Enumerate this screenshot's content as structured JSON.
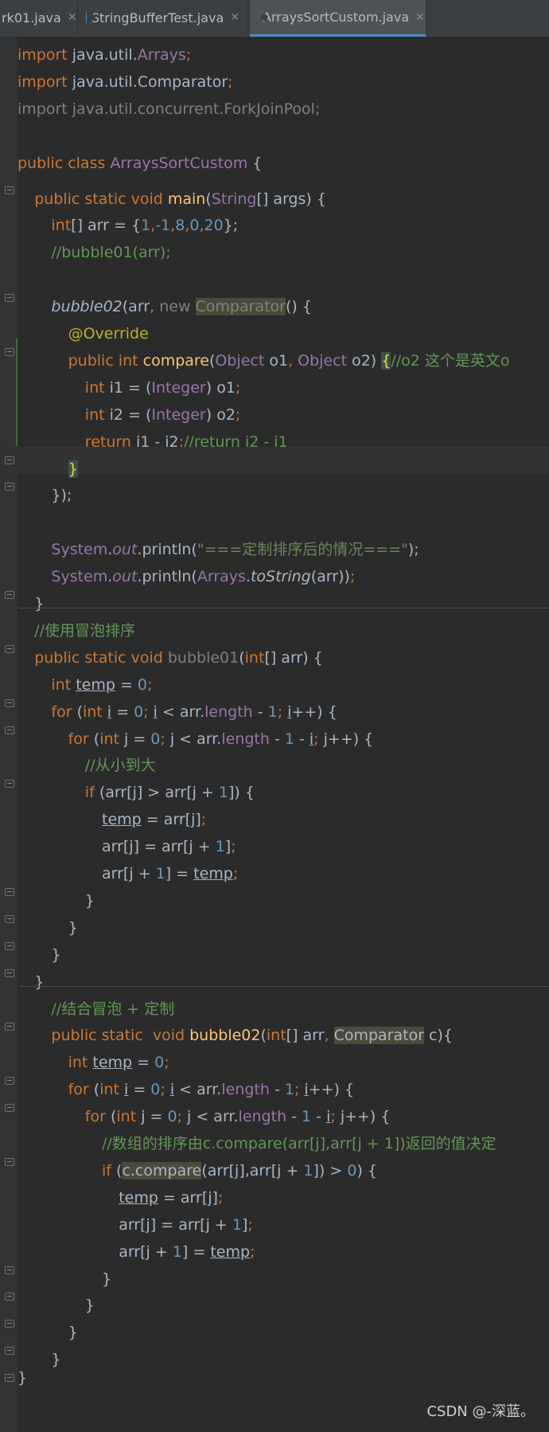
{
  "tabs": [
    {
      "label": "rk01.java",
      "active": false
    },
    {
      "label": "StringBufferTest.java",
      "active": false
    },
    {
      "label": "ArraysSortCustom.java",
      "active": true
    }
  ],
  "lines": [
    [
      [
        "import",
        "k"
      ],
      [
        " java.util.",
        "t"
      ],
      [
        "Arrays",
        "cy"
      ],
      [
        ";",
        "k"
      ]
    ],
    [
      [
        "import",
        "k"
      ],
      [
        " java.util.",
        "t"
      ],
      [
        "Comparator",
        "t"
      ],
      [
        ";",
        "k"
      ]
    ],
    [
      [
        "import java.util.concurrent.ForkJoinPool;",
        "g"
      ]
    ],
    [],
    [
      [
        "public class ",
        "k"
      ],
      [
        "ArraysSortCustom",
        "cy"
      ],
      [
        " {",
        "t"
      ]
    ],
    [
      [
        "  ",
        "t"
      ],
      [
        "public static void ",
        "k"
      ],
      [
        "main",
        "m"
      ],
      [
        "(",
        "t"
      ],
      [
        "String",
        "cy"
      ],
      [
        "[] args) {",
        "t"
      ]
    ],
    [
      [
        "    ",
        "t"
      ],
      [
        "int",
        "k"
      ],
      [
        "[] arr = {",
        "t"
      ],
      [
        "1",
        "n"
      ],
      [
        ",",
        "k"
      ],
      [
        "-1",
        "n"
      ],
      [
        ",",
        "k"
      ],
      [
        "8",
        "n"
      ],
      [
        ",",
        "k"
      ],
      [
        "0",
        "n"
      ],
      [
        ",",
        "k"
      ],
      [
        "20",
        "n"
      ],
      [
        "};",
        "t"
      ]
    ],
    [
      [
        "    ",
        "t"
      ],
      [
        "//bubble01(arr);",
        "cg"
      ]
    ],
    [],
    [
      [
        "    ",
        "t"
      ],
      [
        "bubble02",
        "it"
      ],
      [
        "(arr",
        "t"
      ],
      [
        ", ",
        "k"
      ],
      [
        "new ",
        "g"
      ],
      [
        "Comparator",
        "hlg"
      ],
      [
        "() {",
        "t"
      ]
    ],
    [
      [
        "      ",
        "t"
      ],
      [
        "@Override",
        "a"
      ]
    ],
    [
      [
        "      ",
        "t"
      ],
      [
        "public int ",
        "k"
      ],
      [
        "compare",
        "m"
      ],
      [
        "(",
        "t"
      ],
      [
        "Object ",
        "cy"
      ],
      [
        "o1",
        "t"
      ],
      [
        ", ",
        "k"
      ],
      [
        "Object ",
        "cy"
      ],
      [
        "o2) ",
        "t"
      ],
      [
        "{",
        "br"
      ],
      [
        "//o2 这个是英文o",
        "cg"
      ]
    ],
    [
      [
        "        ",
        "t"
      ],
      [
        "int ",
        "k"
      ],
      [
        "i1 = (",
        "t"
      ],
      [
        "Integer",
        "cy"
      ],
      [
        ") o1",
        "t"
      ],
      [
        ";",
        "k"
      ]
    ],
    [
      [
        "        ",
        "t"
      ],
      [
        "int ",
        "k"
      ],
      [
        "i2 = (",
        "t"
      ],
      [
        "Integer",
        "cy"
      ],
      [
        ") o2",
        "t"
      ],
      [
        ";",
        "k"
      ]
    ],
    [
      [
        "        ",
        "t"
      ],
      [
        "return ",
        "k"
      ],
      [
        "i1 - i2",
        "t"
      ],
      [
        ";",
        "k"
      ],
      [
        "//return i2 - i1",
        "cg"
      ]
    ],
    [
      [
        "      ",
        "t"
      ],
      [
        "}",
        "br"
      ]
    ],
    [
      [
        "    ",
        "t"
      ],
      [
        "});",
        "t"
      ]
    ],
    [],
    [
      [
        "    ",
        "t"
      ],
      [
        "System",
        "cy"
      ],
      [
        ".",
        "t"
      ],
      [
        "out",
        "cyi"
      ],
      [
        ".println(",
        "t"
      ],
      [
        "\"===定制排序后的情况===\"",
        "s"
      ],
      [
        ");",
        "t"
      ]
    ],
    [
      [
        "    ",
        "t"
      ],
      [
        "System",
        "cy"
      ],
      [
        ".",
        "t"
      ],
      [
        "out",
        "cyi"
      ],
      [
        ".println(",
        "t"
      ],
      [
        "Arrays",
        "cy"
      ],
      [
        ".",
        "t"
      ],
      [
        "toString",
        "it"
      ],
      [
        "(arr))",
        "t"
      ],
      [
        ";",
        "k"
      ]
    ],
    [
      [
        "  ",
        "t"
      ],
      [
        "}",
        "t"
      ]
    ],
    [
      [
        "  ",
        "t"
      ],
      [
        "//使用冒泡排序",
        "cg"
      ]
    ],
    [
      [
        "  ",
        "t"
      ],
      [
        "public static void ",
        "k"
      ],
      [
        "bubble01",
        "g"
      ],
      [
        "(",
        "t"
      ],
      [
        "int",
        "k"
      ],
      [
        "[] arr) {",
        "t"
      ]
    ],
    [
      [
        "    ",
        "t"
      ],
      [
        "int ",
        "k"
      ],
      [
        "temp",
        "ul"
      ],
      [
        " = ",
        "t"
      ],
      [
        "0",
        "n"
      ],
      [
        ";",
        "k"
      ]
    ],
    [
      [
        "    ",
        "t"
      ],
      [
        "for ",
        "k"
      ],
      [
        "(",
        "t"
      ],
      [
        "int ",
        "k"
      ],
      [
        "i",
        "ul"
      ],
      [
        " = ",
        "t"
      ],
      [
        "0",
        "n"
      ],
      [
        "; ",
        "k"
      ],
      [
        "i",
        "ul"
      ],
      [
        " < arr.",
        "t"
      ],
      [
        "length",
        "cy"
      ],
      [
        " - ",
        "t"
      ],
      [
        "1",
        "n"
      ],
      [
        "; ",
        "k"
      ],
      [
        "i",
        "ul"
      ],
      [
        "++) {",
        "t"
      ]
    ],
    [
      [
        "      ",
        "t"
      ],
      [
        "for ",
        "k"
      ],
      [
        "(",
        "t"
      ],
      [
        "int ",
        "k"
      ],
      [
        "j = ",
        "t"
      ],
      [
        "0",
        "n"
      ],
      [
        "; ",
        "k"
      ],
      [
        "j < arr.",
        "t"
      ],
      [
        "length",
        "cy"
      ],
      [
        " - ",
        "t"
      ],
      [
        "1",
        "n"
      ],
      [
        " - ",
        "t"
      ],
      [
        "i",
        "ul"
      ],
      [
        "; ",
        "k"
      ],
      [
        "j++) {",
        "t"
      ]
    ],
    [
      [
        "        ",
        "t"
      ],
      [
        "//从小到大",
        "cg"
      ]
    ],
    [
      [
        "        ",
        "t"
      ],
      [
        "if ",
        "k"
      ],
      [
        "(arr[j] > arr[j + ",
        "t"
      ],
      [
        "1",
        "n"
      ],
      [
        "]) {",
        "t"
      ]
    ],
    [
      [
        "          ",
        "t"
      ],
      [
        "temp",
        "ul"
      ],
      [
        " = arr[j]",
        "t"
      ],
      [
        ";",
        "k"
      ]
    ],
    [
      [
        "          ",
        "t"
      ],
      [
        "arr[j] = arr[j + ",
        "t"
      ],
      [
        "1",
        "n"
      ],
      [
        "]",
        "t"
      ],
      [
        ";",
        "k"
      ]
    ],
    [
      [
        "          ",
        "t"
      ],
      [
        "arr[j + ",
        "t"
      ],
      [
        "1",
        "n"
      ],
      [
        "] = ",
        "t"
      ],
      [
        "temp",
        "ul"
      ],
      [
        ";",
        "k"
      ]
    ],
    [
      [
        "        ",
        "t"
      ],
      [
        "}",
        "t"
      ]
    ],
    [
      [
        "      ",
        "t"
      ],
      [
        "}",
        "t"
      ]
    ],
    [
      [
        "    ",
        "t"
      ],
      [
        "}",
        "t"
      ]
    ],
    [
      [
        "  ",
        "t"
      ],
      [
        "}",
        "t"
      ]
    ],
    [
      [
        "    ",
        "t"
      ],
      [
        "//结合冒泡 + 定制",
        "cg"
      ]
    ],
    [
      [
        "    ",
        "t"
      ],
      [
        "public static  void ",
        "k"
      ],
      [
        "bubble02",
        "m"
      ],
      [
        "(",
        "t"
      ],
      [
        "int",
        "k"
      ],
      [
        "[] arr",
        "t"
      ],
      [
        ", ",
        "k"
      ],
      [
        "Comparator",
        "hlt"
      ],
      [
        " c){",
        "t"
      ]
    ],
    [
      [
        "      ",
        "t"
      ],
      [
        "int ",
        "k"
      ],
      [
        "temp",
        "ul"
      ],
      [
        " = ",
        "t"
      ],
      [
        "0",
        "n"
      ],
      [
        ";",
        "k"
      ]
    ],
    [
      [
        "      ",
        "t"
      ],
      [
        "for ",
        "k"
      ],
      [
        "(",
        "t"
      ],
      [
        "int ",
        "k"
      ],
      [
        "i",
        "ul"
      ],
      [
        " = ",
        "t"
      ],
      [
        "0",
        "n"
      ],
      [
        "; ",
        "k"
      ],
      [
        "i",
        "ul"
      ],
      [
        " < arr.",
        "t"
      ],
      [
        "length",
        "cy"
      ],
      [
        " - ",
        "t"
      ],
      [
        "1",
        "n"
      ],
      [
        "; ",
        "k"
      ],
      [
        "i",
        "ul"
      ],
      [
        "++) {",
        "t"
      ]
    ],
    [
      [
        "        ",
        "t"
      ],
      [
        "for ",
        "k"
      ],
      [
        "(",
        "t"
      ],
      [
        "int ",
        "k"
      ],
      [
        "j = ",
        "t"
      ],
      [
        "0",
        "n"
      ],
      [
        "; ",
        "k"
      ],
      [
        "j < arr.",
        "t"
      ],
      [
        "length",
        "cy"
      ],
      [
        " - ",
        "t"
      ],
      [
        "1",
        "n"
      ],
      [
        " - ",
        "t"
      ],
      [
        "i",
        "ul"
      ],
      [
        "; ",
        "k"
      ],
      [
        "j++) {",
        "t"
      ]
    ],
    [
      [
        "          ",
        "t"
      ],
      [
        "//数组的排序由c.compare(arr[j],arr[j + 1])返回的值决定",
        "cg"
      ]
    ],
    [
      [
        "          ",
        "t"
      ],
      [
        "if ",
        "k"
      ],
      [
        "(",
        "t"
      ],
      [
        "c.compare",
        "hlt"
      ],
      [
        "(arr[j],arr[j + ",
        "t"
      ],
      [
        "1",
        "n"
      ],
      [
        "]) > ",
        "t"
      ],
      [
        "0",
        "n"
      ],
      [
        ") {",
        "t"
      ]
    ],
    [
      [
        "            ",
        "t"
      ],
      [
        "temp",
        "ul"
      ],
      [
        " = arr[j]",
        "t"
      ],
      [
        ";",
        "k"
      ]
    ],
    [
      [
        "            ",
        "t"
      ],
      [
        "arr[j] = arr[j + ",
        "t"
      ],
      [
        "1",
        "n"
      ],
      [
        "]",
        "t"
      ],
      [
        ";",
        "k"
      ]
    ],
    [
      [
        "            ",
        "t"
      ],
      [
        "arr[j + ",
        "t"
      ],
      [
        "1",
        "n"
      ],
      [
        "] = ",
        "t"
      ],
      [
        "temp",
        "ul"
      ],
      [
        ";",
        "k"
      ]
    ],
    [
      [
        "          ",
        "t"
      ],
      [
        "}",
        "t"
      ]
    ],
    [
      [
        "        ",
        "t"
      ],
      [
        "}",
        "t"
      ]
    ],
    [
      [
        "      ",
        "t"
      ],
      [
        "}",
        "t"
      ]
    ],
    [
      [
        "    ",
        "t"
      ],
      [
        "}",
        "t"
      ]
    ],
    [
      [
        "}",
        "t"
      ]
    ]
  ],
  "watermark": "CSDN @-深蓝。"
}
